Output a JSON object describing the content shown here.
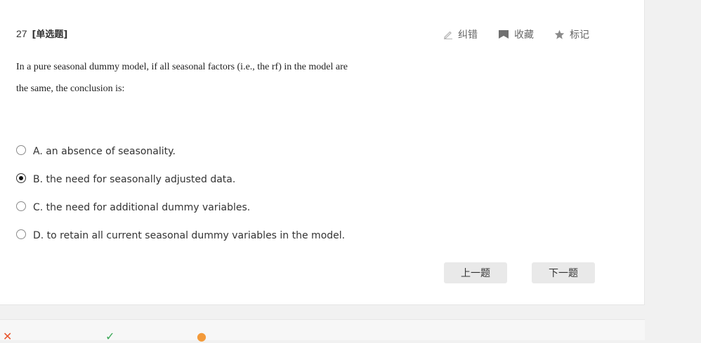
{
  "question": {
    "number": "27",
    "type_label": "[单选题]",
    "stem_line1": "In a pure seasonal dummy model, if all seasonal factors (i.e., the rf) in the model are",
    "stem_line2": "the same, the conclusion is:"
  },
  "actions": {
    "report_label": "纠错",
    "favorite_label": "收藏",
    "mark_label": "标记",
    "report_icon": "pencil-icon",
    "favorite_icon": "bookmark-icon",
    "mark_icon": "star-icon"
  },
  "options": [
    {
      "text": "A. an absence of seasonality.",
      "selected": false
    },
    {
      "text": "B. the need for seasonally adjusted data.",
      "selected": true
    },
    {
      "text": "C. the need for additional dummy variables.",
      "selected": false
    },
    {
      "text": "D. to retain all current seasonal dummy variables in the model.",
      "selected": false
    }
  ],
  "nav": {
    "prev_label": "上一题",
    "next_label": "下一题"
  },
  "colors": {
    "wrong_mark": "#e8542b",
    "right_mark": "#3aa856",
    "orange_mark": "#f39a3a"
  }
}
